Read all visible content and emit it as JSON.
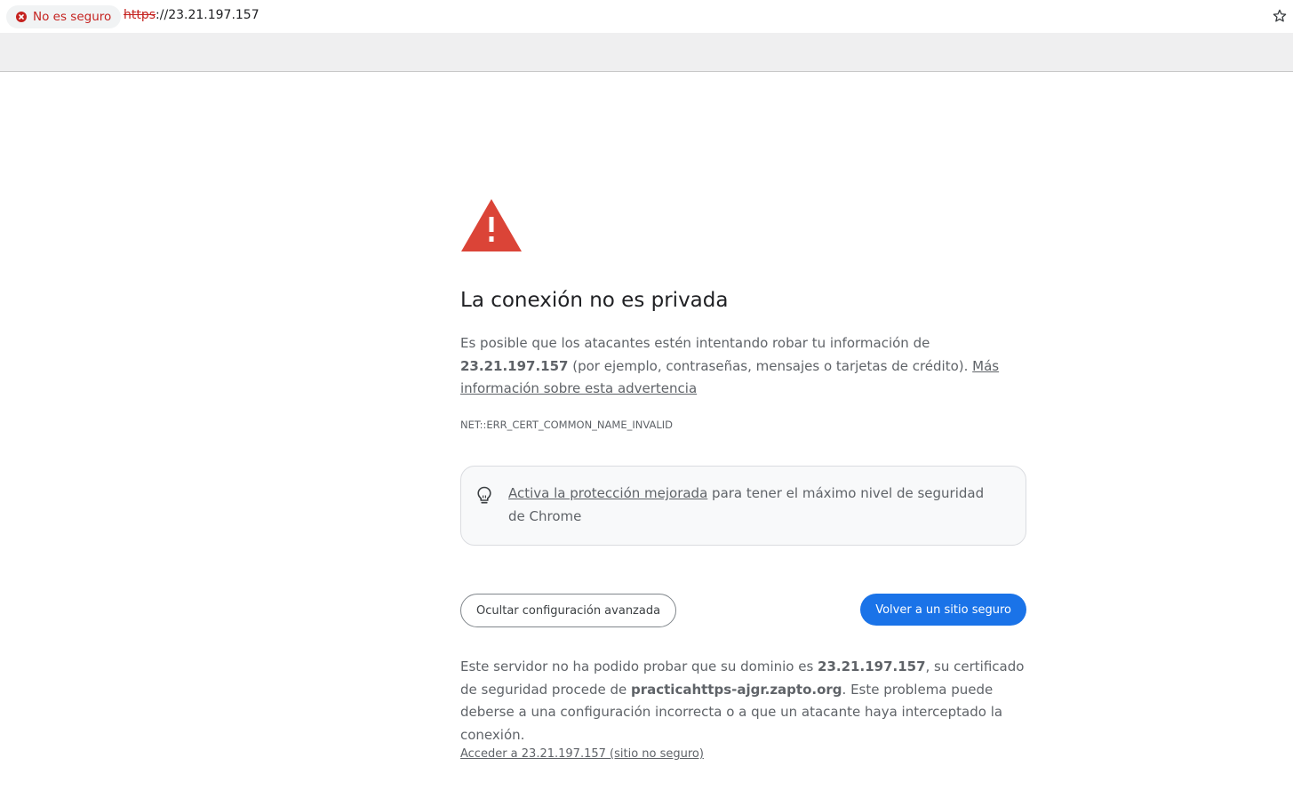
{
  "browser": {
    "security_chip": {
      "label": "No es seguro",
      "icon": "error-circle-icon",
      "color": "#c5221f"
    },
    "url": {
      "scheme": "https",
      "rest": "://23.21.197.157"
    },
    "bookmark_icon": "star-icon"
  },
  "interstitial": {
    "warning_icon": "warning-triangle-icon",
    "warning_color": "#db4437",
    "heading": "La conexión no es privada",
    "message": {
      "part1": "Es posible que los atacantes estén intentando robar tu información de ",
      "host": "23.21.197.157",
      "part2": " (por ejemplo, contraseñas, mensajes o tarjetas de crédito). ",
      "learn_more": "Más información sobre esta advertencia"
    },
    "error_code": "NET::ERR_CERT_COMMON_NAME_INVALID",
    "enhanced_protection": {
      "icon": "lightbulb-icon",
      "link": "Activa la protección mejorada",
      "text": " para tener el máximo nivel de seguridad de Chrome"
    },
    "buttons": {
      "advanced": "Ocultar configuración avanzada",
      "back_to_safety": "Volver a un sitio seguro",
      "primary_color": "#1a73e8"
    },
    "details": {
      "part1": "Este servidor no ha podido probar que su dominio es ",
      "host": "23.21.197.157",
      "part2": ", su certificado de seguridad procede de ",
      "cert_domain": "practicahttps-ajgr.zapto.org",
      "part3": ". Este problema puede deberse a una configuración incorrecta o a que un atacante haya interceptado la conexión."
    },
    "proceed_link": "Acceder a 23.21.197.157 (sitio no seguro)"
  }
}
